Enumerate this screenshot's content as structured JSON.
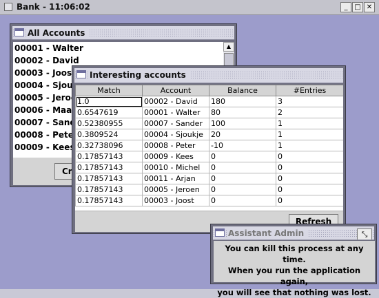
{
  "app": {
    "title": "Bank - 11:06:02",
    "buttons": {
      "minimize": "_",
      "maximize": "□",
      "close": "✕"
    }
  },
  "all_accounts": {
    "title": "All Accounts",
    "items": [
      "00001 - Walter",
      "00002 - David",
      "00003 - Joost",
      "00004 - Sjoukje",
      "00005 - Jeroen",
      "00006 - Maarten",
      "00007 - Sander",
      "00008 - Peter",
      "00009 - Kees"
    ],
    "button_partial": "Cr"
  },
  "interesting": {
    "title": "Interesting accounts",
    "columns": [
      "Match",
      "Account",
      "Balance",
      "#Entries"
    ],
    "rows": [
      [
        "1.0",
        "00002 - David",
        "180",
        "3"
      ],
      [
        "0.6547619",
        "00001 - Walter",
        "80",
        "2"
      ],
      [
        "0.52380955",
        "00007 - Sander",
        "100",
        "1"
      ],
      [
        "0.3809524",
        "00004 - Sjoukje",
        "20",
        "1"
      ],
      [
        "0.32738096",
        "00008 - Peter",
        "-10",
        "1"
      ],
      [
        "0.17857143",
        "00009 - Kees",
        "0",
        "0"
      ],
      [
        "0.17857143",
        "00010 - Michel",
        "0",
        "0"
      ],
      [
        "0.17857143",
        "00011 - Arjan",
        "0",
        "0"
      ],
      [
        "0.17857143",
        "00005 - Jeroen",
        "0",
        "0"
      ],
      [
        "0.17857143",
        "00003 - Joost",
        "0",
        "0"
      ]
    ],
    "refresh_label": "Refresh"
  },
  "assistant": {
    "title": "Assistant Admin",
    "message": [
      "You can kill this process at any time.",
      "When you run the application again,",
      "you will see that nothing was lost."
    ]
  }
}
